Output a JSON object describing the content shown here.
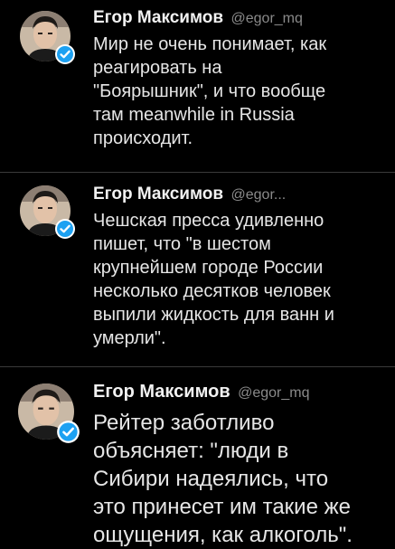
{
  "tweets": [
    {
      "name": "Егор Максимов",
      "handle": "@egor_mq",
      "text": "Мир не очень понимает, как\nреагировать на\n\"Боярышник\", и что вообще\nтам meanwhile in Russia\nпроисходит.",
      "avatar_icon": "user-avatar",
      "verified_icon": "verified-badge-icon"
    },
    {
      "name": "Егор Максимов",
      "handle": "@egor...",
      "text": "Чешская пресса удивленно\nпишет, что \"в шестом\nкрупнейшем городе России\nнесколько десятков человек\nвыпили жидкость для ванн и\nумерли\".",
      "avatar_icon": "user-avatar",
      "verified_icon": "verified-badge-icon"
    },
    {
      "name": "Егор Максимов",
      "handle": "@egor_mq",
      "text": "Рейтер заботливо\nобъясняет: \"люди в\nСибири надеялись, что\nэто принесет им такие же\nощущения, как алкоголь\".",
      "avatar_icon": "user-avatar",
      "verified_icon": "verified-badge-icon"
    }
  ],
  "colors": {
    "background": "#000000",
    "divider": "#3a3a3a",
    "name": "#f2f2f2",
    "handle": "#8a8a8a",
    "verified": "#1da1f2"
  }
}
